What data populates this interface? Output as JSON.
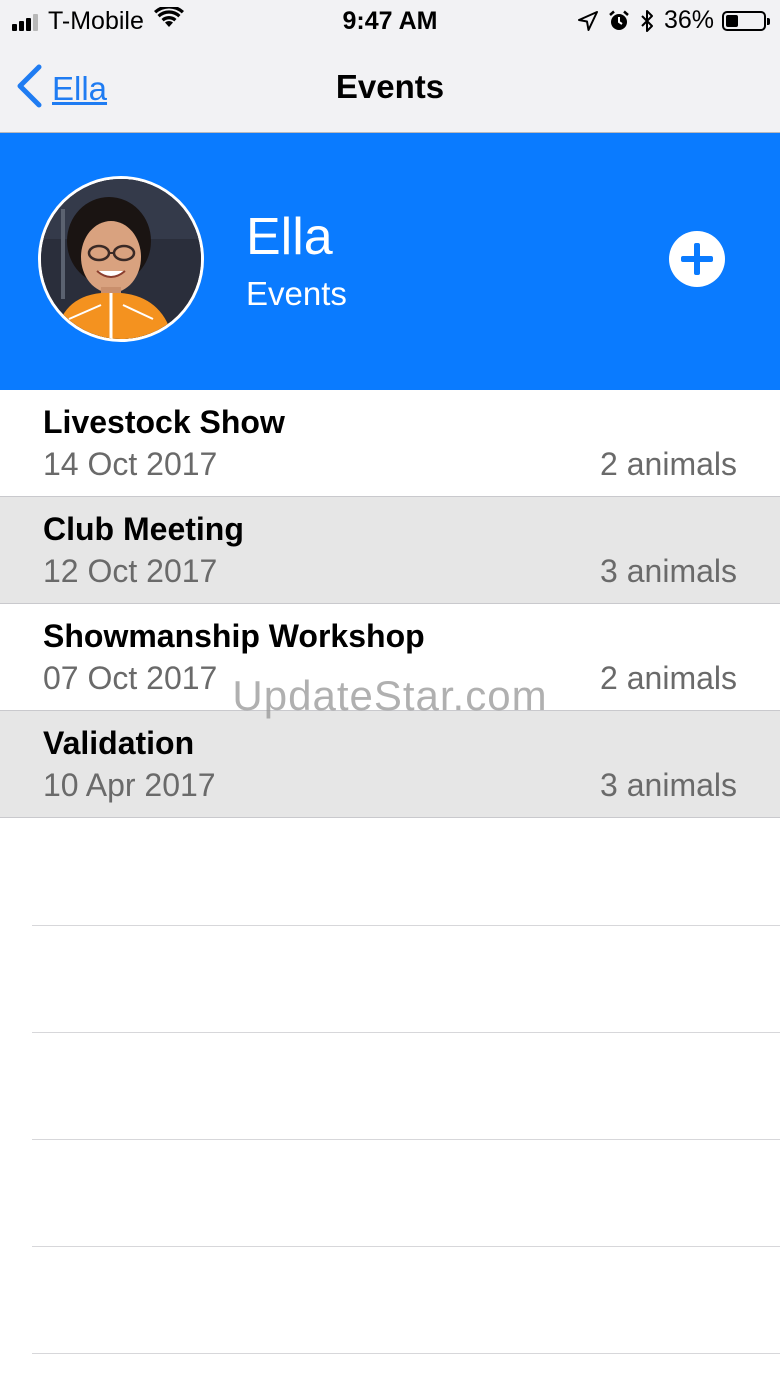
{
  "status_bar": {
    "carrier": "T-Mobile",
    "time": "9:47 AM",
    "battery_percent": "36%",
    "icons": [
      "signal-icon",
      "wifi-icon",
      "location-arrow-icon",
      "alarm-icon",
      "bluetooth-icon",
      "battery-icon"
    ]
  },
  "nav": {
    "back_label": "Ella",
    "title": "Events"
  },
  "header": {
    "name": "Ella",
    "subtitle": "Events",
    "add_icon": "plus-circle-icon"
  },
  "events": [
    {
      "name": "Livestock Show",
      "date": "14 Oct 2017",
      "animals": "2 animals"
    },
    {
      "name": "Club Meeting",
      "date": "12 Oct 2017",
      "animals": "3 animals"
    },
    {
      "name": "Showmanship Workshop",
      "date": "07 Oct 2017",
      "animals": "2 animals"
    },
    {
      "name": "Validation",
      "date": "10 Apr 2017",
      "animals": "3 animals"
    }
  ],
  "watermark": "UpdateStar.com",
  "colors": {
    "accent": "#0a7bff",
    "link": "#1f7cf2",
    "alt_row": "#e6e6e6"
  }
}
